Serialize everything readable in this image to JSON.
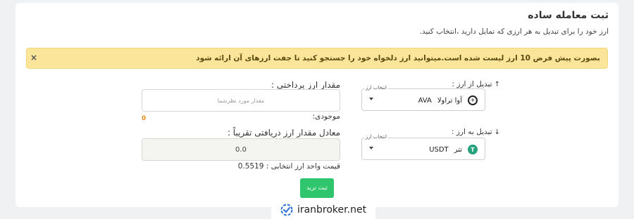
{
  "header": {
    "title": "ثبت معامله ساده",
    "subtitle": "ارز خود را برای تبدیل به هر ارزی که تمایل دارید ،انتخاب کنید."
  },
  "alert": {
    "text": "بصورت پیش فرض 10 ارز لیست شده است.میتوانید ارز دلخواه خود را جستجو کنید تا جفت ارزهای آن ارائه شود",
    "close_label": "×"
  },
  "from": {
    "label": "تبدیل از ارز :",
    "arrow": "↑",
    "select_legend": "انتخاب ارز",
    "currency_name": "آوا تراولا",
    "currency_symbol": "AVA",
    "coin_glyph": "✈",
    "icon": "ava-coin-icon"
  },
  "to": {
    "label": "تبدیل به ارز :",
    "arrow": "↓",
    "select_legend": "انتخاب ارز",
    "currency_name": "تتر",
    "currency_symbol": "USDT",
    "coin_glyph": "T",
    "icon": "usdt-coin-icon"
  },
  "pay": {
    "label": "مقدار ارز پرداختی :",
    "placeholder": "مقدار مورد نظرشما",
    "balance_label": "موجودی:",
    "balance_value": "0"
  },
  "receive": {
    "label": "معادل مقدار ارز دریافتی تقریباً :",
    "value": "0.0",
    "unit_price_label": "قیمت واحد ارز انتخابی : 0.5519"
  },
  "submit_label": "ثبت ترید",
  "watermark": {
    "text": "iranbroker.net"
  },
  "colors": {
    "alert_bg": "#fbe59a",
    "submit_bg": "#2fc56c",
    "balance": "#e68a1c",
    "usdt": "#26a17b"
  }
}
